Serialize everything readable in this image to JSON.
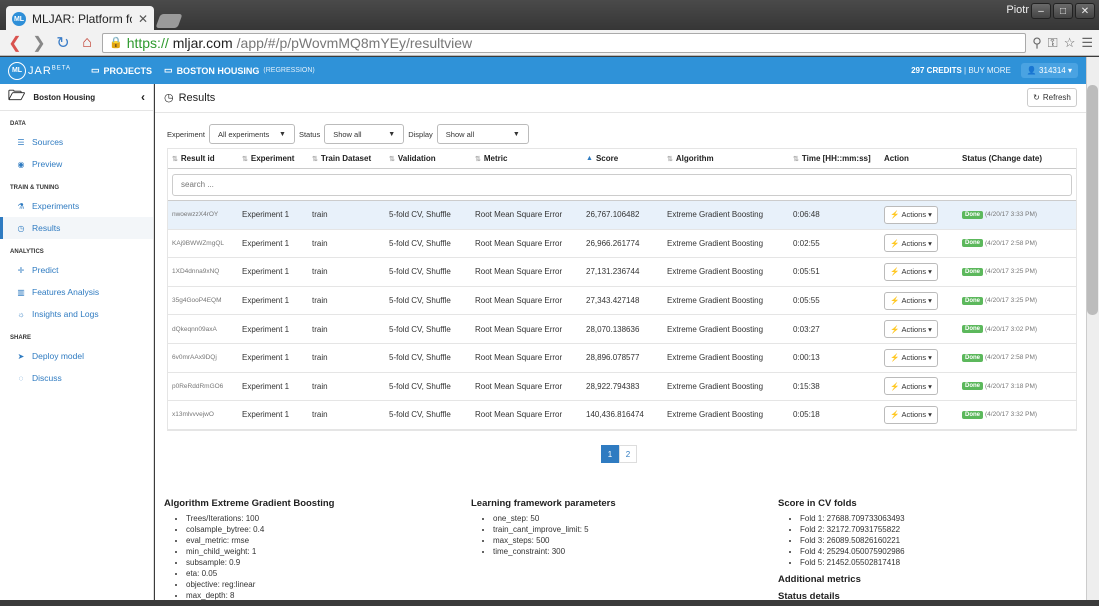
{
  "browser": {
    "tab_title": "MLJAR: Platform for",
    "tab_favicon": "ML",
    "user_name": "Piotr",
    "url_proto": "https://",
    "url_host": "mljar.com",
    "url_path": "/app/#/p/pWovmMQ8mYEy/resultview"
  },
  "header": {
    "logo_text": "JAR",
    "logo_beta": "BETA",
    "logo_mark": "ML",
    "nav_projects": "PROJECTS",
    "nav_project": "BOSTON HOUSING",
    "nav_project_sub": "(REGRESSION)",
    "credits": "297 CREDITS",
    "buy_more": "| BUY MORE",
    "user_id": "314314"
  },
  "sidebar": {
    "title": "Boston Housing",
    "sections": [
      {
        "label": "DATA",
        "items": [
          {
            "label": "Sources",
            "icon": "database-icon"
          },
          {
            "label": "Preview",
            "icon": "eye-icon"
          }
        ]
      },
      {
        "label": "TRAIN & TUNING",
        "items": [
          {
            "label": "Experiments",
            "icon": "flask-icon"
          },
          {
            "label": "Results",
            "icon": "dashboard-icon"
          }
        ]
      },
      {
        "label": "ANALYTICS",
        "items": [
          {
            "label": "Predict",
            "icon": "crosshair-icon"
          },
          {
            "label": "Features Analysis",
            "icon": "bar-chart-icon"
          },
          {
            "label": "Insights and Logs",
            "icon": "lightbulb-icon"
          }
        ]
      },
      {
        "label": "SHARE",
        "items": [
          {
            "label": "Deploy model",
            "icon": "send-icon"
          },
          {
            "label": "Discuss",
            "icon": "comment-icon"
          }
        ]
      }
    ]
  },
  "main": {
    "title": "Results",
    "refresh": "Refresh",
    "filters": {
      "experiment_label": "Experiment",
      "experiment_value": "All experiments",
      "status_label": "Status",
      "status_value": "Show all",
      "display_label": "Display",
      "display_value": "Show all"
    },
    "columns": [
      "Result id",
      "Experiment",
      "Train Dataset",
      "Validation",
      "Metric",
      "Score",
      "Algorithm",
      "Time [HH::mm:ss]",
      "Action",
      "Status (Change date)"
    ],
    "search_placeholder": "search ...",
    "rows": [
      {
        "id": "nwoewzzX4rOY",
        "experiment": "Experiment 1",
        "dataset": "train",
        "validation": "5-fold CV, Shuffle",
        "metric": "Root Mean Square Error",
        "score": "26,767.106482",
        "algorithm": "Extreme Gradient Boosting",
        "time": "0:06:48",
        "action": "Actions",
        "status": "Done",
        "date": "(4/20/17 3:33 PM)"
      },
      {
        "id": "KAj9BWWZmgQL",
        "experiment": "Experiment 1",
        "dataset": "train",
        "validation": "5-fold CV, Shuffle",
        "metric": "Root Mean Square Error",
        "score": "26,966.261774",
        "algorithm": "Extreme Gradient Boosting",
        "time": "0:02:55",
        "action": "Actions",
        "status": "Done",
        "date": "(4/20/17 2:58 PM)"
      },
      {
        "id": "1XD4dnna9xNQ",
        "experiment": "Experiment 1",
        "dataset": "train",
        "validation": "5-fold CV, Shuffle",
        "metric": "Root Mean Square Error",
        "score": "27,131.236744",
        "algorithm": "Extreme Gradient Boosting",
        "time": "0:05:51",
        "action": "Actions",
        "status": "Done",
        "date": "(4/20/17 3:25 PM)"
      },
      {
        "id": "35g4GooP4EQM",
        "experiment": "Experiment 1",
        "dataset": "train",
        "validation": "5-fold CV, Shuffle",
        "metric": "Root Mean Square Error",
        "score": "27,343.427148",
        "algorithm": "Extreme Gradient Boosting",
        "time": "0:05:55",
        "action": "Actions",
        "status": "Done",
        "date": "(4/20/17 3:25 PM)"
      },
      {
        "id": "dQkeqnn09axA",
        "experiment": "Experiment 1",
        "dataset": "train",
        "validation": "5-fold CV, Shuffle",
        "metric": "Root Mean Square Error",
        "score": "28,070.138636",
        "algorithm": "Extreme Gradient Boosting",
        "time": "0:03:27",
        "action": "Actions",
        "status": "Done",
        "date": "(4/20/17 3:02 PM)"
      },
      {
        "id": "6v0mrAAx9DQj",
        "experiment": "Experiment 1",
        "dataset": "train",
        "validation": "5-fold CV, Shuffle",
        "metric": "Root Mean Square Error",
        "score": "28,896.078577",
        "algorithm": "Extreme Gradient Boosting",
        "time": "0:00:13",
        "action": "Actions",
        "status": "Done",
        "date": "(4/20/17 2:58 PM)"
      },
      {
        "id": "p0ReRddRmGO6",
        "experiment": "Experiment 1",
        "dataset": "train",
        "validation": "5-fold CV, Shuffle",
        "metric": "Root Mean Square Error",
        "score": "28,922.794383",
        "algorithm": "Extreme Gradient Boosting",
        "time": "0:15:38",
        "action": "Actions",
        "status": "Done",
        "date": "(4/20/17 3:18 PM)"
      },
      {
        "id": "x13mlvvvejwO",
        "experiment": "Experiment 1",
        "dataset": "train",
        "validation": "5-fold CV, Shuffle",
        "metric": "Root Mean Square Error",
        "score": "140,436.816474",
        "algorithm": "Extreme Gradient Boosting",
        "time": "0:05:18",
        "action": "Actions",
        "status": "Done",
        "date": "(4/20/17 3:32 PM)"
      }
    ],
    "pages": [
      "1",
      "2"
    ]
  },
  "details": {
    "algo_title": "Algorithm Extreme Gradient Boosting",
    "algo_params": [
      "Trees/Iterations: 100",
      "colsample_bytree: 0.4",
      "eval_metric: rmse",
      "min_child_weight: 1",
      "subsample: 0.9",
      "eta: 0.05",
      "objective: reg:linear",
      "max_depth: 8"
    ],
    "framework_title": "Learning framework parameters",
    "framework_params": [
      "one_step: 50",
      "train_cant_improve_limit: 5",
      "max_steps: 500",
      "time_constraint: 300"
    ],
    "cv_title": "Score in CV folds",
    "cv_folds": [
      "Fold 1: 27688.709733063493",
      "Fold 2: 32172.70931755822",
      "Fold 3: 26089.50826160221",
      "Fold 4: 25294.050075902986",
      "Fold 5: 21452.05502817418"
    ],
    "additional_title": "Additional metrics",
    "status_title": "Status details"
  }
}
